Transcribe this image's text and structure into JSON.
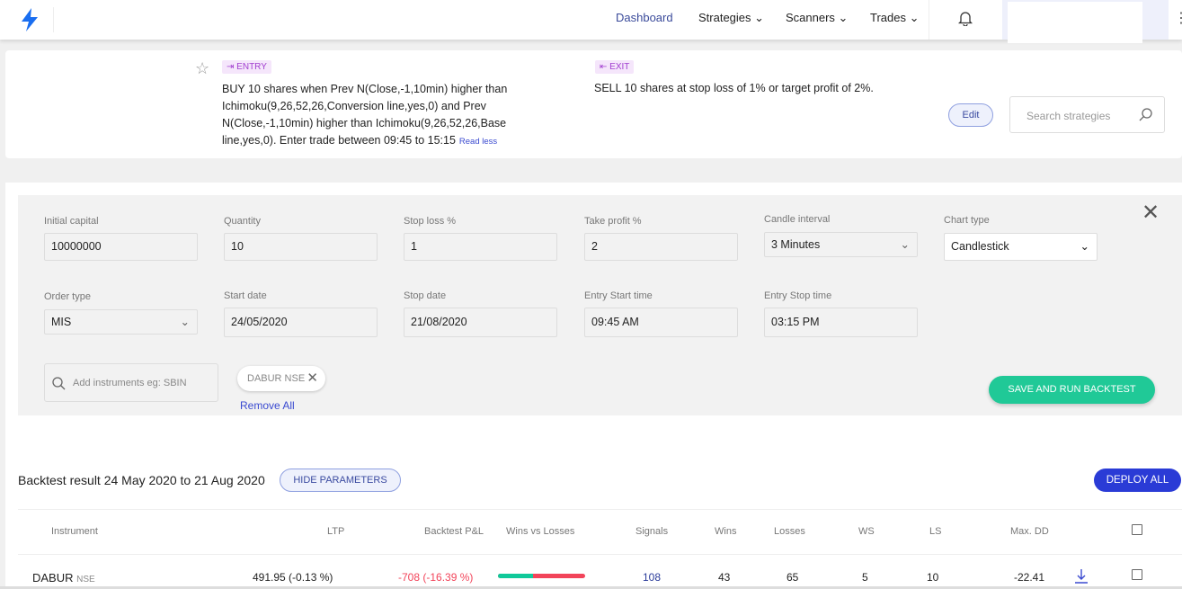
{
  "nav": {
    "items": [
      {
        "label": "Dashboard"
      },
      {
        "label": "Strategies"
      },
      {
        "label": "Scanners"
      },
      {
        "label": "Trades"
      }
    ],
    "accent": "#1a6ef0"
  },
  "strategy": {
    "entry_tag": "ENTRY",
    "entry_text": "BUY 10 shares when Prev N(Close,-1,10min) higher than Ichimoku(9,26,52,26,Conversion line,yes,0) and Prev N(Close,-1,10min) higher than Ichimoku(9,26,52,26,Base line,yes,0). Enter trade between 09:45 to 15:15",
    "read_less": "Read less",
    "exit_tag": "EXIT",
    "exit_text": "SELL 10 shares at stop loss of 1% or target profit of 2%.",
    "edit": "Edit",
    "search_placeholder": "Search strategies"
  },
  "params": {
    "initial_capital": {
      "label": "Initial capital",
      "value": "10000000"
    },
    "quantity": {
      "label": "Quantity",
      "value": "10"
    },
    "stop_loss": {
      "label": "Stop loss %",
      "value": "1"
    },
    "take_profit": {
      "label": "Take profit %",
      "value": "2"
    },
    "candle_interval": {
      "label": "Candle interval",
      "value": "3 Minutes"
    },
    "chart_type": {
      "label": "Chart type",
      "value": "Candlestick"
    },
    "order_type": {
      "label": "Order type",
      "value": "MIS"
    },
    "start_date": {
      "label": "Start date",
      "value": "24/05/2020"
    },
    "stop_date": {
      "label": "Stop date",
      "value": "21/08/2020"
    },
    "entry_start": {
      "label": "Entry Start time",
      "value": "09:45 AM"
    },
    "entry_stop": {
      "label": "Entry Stop time",
      "value": "03:15 PM"
    },
    "instrument_placeholder": "Add instruments eg: SBIN",
    "chip": "DABUR NSE",
    "remove_all": "Remove All",
    "save_run": "SAVE AND RUN BACKTEST"
  },
  "results": {
    "title": "Backtest result 24 May 2020 to 21 Aug 2020",
    "hide": "HIDE PARAMETERS",
    "deploy": "DEPLOY ALL",
    "headers": [
      "Instrument",
      "LTP",
      "Backtest P&L",
      "Wins vs Losses",
      "Signals",
      "Wins",
      "Losses",
      "WS",
      "LS",
      "Max. DD"
    ],
    "rows": [
      {
        "symbol": "DABUR",
        "exchange": "NSE",
        "ltp": "491.95 (-0.13 %)",
        "pnl": "-708 (-16.39 %)",
        "win_fraction": 0.398,
        "signals": "108",
        "wins": "43",
        "losses": "65",
        "ws": "5",
        "ls": "10",
        "max_dd": "-22.41"
      }
    ]
  }
}
